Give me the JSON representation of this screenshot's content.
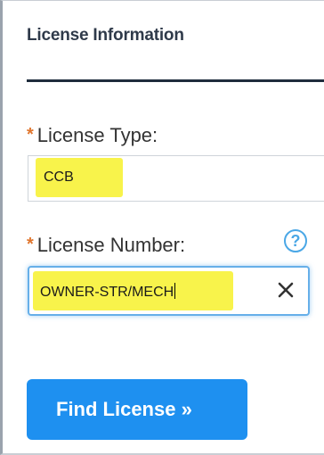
{
  "section": {
    "title": "License Information"
  },
  "fields": {
    "license_type": {
      "required_mark": "*",
      "label": "License Type:",
      "value": "CCB"
    },
    "license_number": {
      "required_mark": "*",
      "label": "License Number:",
      "value": "OWNER-STR/MECH",
      "help_icon": "?",
      "clear_icon": "close-icon"
    }
  },
  "actions": {
    "find_label": "Find License »"
  },
  "colors": {
    "required": "#e0762e",
    "highlight": "#f8f34b",
    "accent": "#1e90f0",
    "focus_border": "#66afe9",
    "help": "#4aa7e6",
    "rule": "#1f2d3d"
  }
}
